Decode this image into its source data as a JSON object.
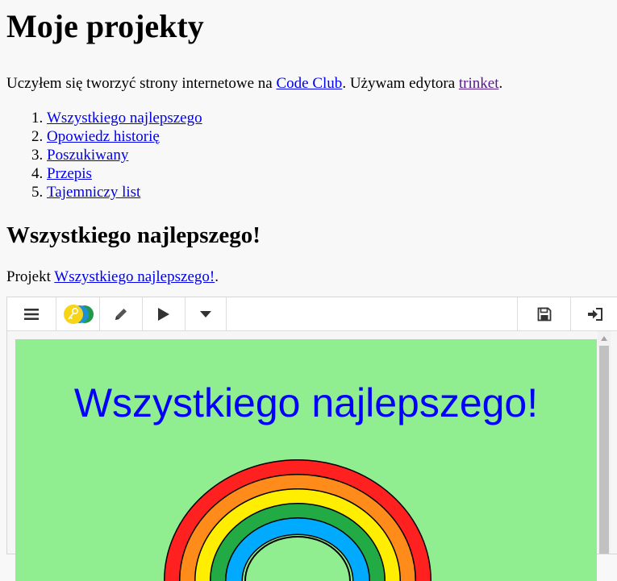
{
  "page": {
    "title": "Moje projekty",
    "intro": {
      "text_before": "Uczyłem się tworzyć strony internetowe na ",
      "link1": "Code Club",
      "text_middle": ". Używam edytora ",
      "link2": "trinket",
      "text_after": "."
    },
    "projects": [
      "Wszystkiego najlepszego",
      "Opowiedz historię",
      "Poszukiwany",
      "Przepis",
      "Tajemniczy list"
    ],
    "section_title": "Wszystkiego najlepszego!",
    "project_line": {
      "text_before": "Projekt ",
      "link": "Wszystkiego najlepszego!",
      "text_after": "."
    }
  },
  "embed": {
    "toolbar": {
      "buttons": [
        "menu-icon",
        "trinket-logo-icon",
        "pencil-icon",
        "play-icon",
        "caret-down-icon",
        "save-icon",
        "sign-in-icon"
      ]
    },
    "canvas": {
      "title": "Wszystkiego najlepszego!",
      "background": "#90ee90",
      "title_color": "#0000ff",
      "rainbow_colors": [
        "#ff2020",
        "#ff8c1a",
        "#ffee00",
        "#22aa44",
        "#00aaff"
      ]
    }
  }
}
